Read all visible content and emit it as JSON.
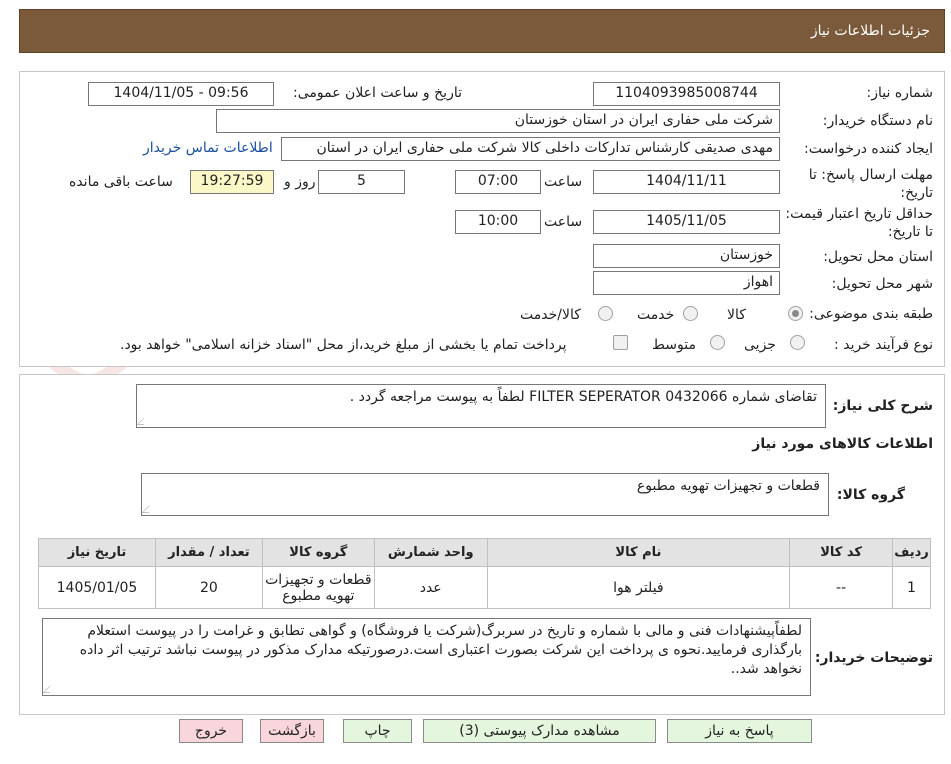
{
  "header": {
    "title": "جزئیات اطلاعات نیاز"
  },
  "watermark": {
    "text": "AriaTender.net"
  },
  "form": {
    "need_number": {
      "label": "شماره نیاز:",
      "value": "1104093985008744"
    },
    "announce_datetime": {
      "label": "تاریخ و ساعت اعلان عمومی:",
      "value": "1404/11/05 - 09:56"
    },
    "buyer_org": {
      "label": "نام دستگاه خریدار:",
      "value": "شرکت ملی حفاری ایران در استان خوزستان"
    },
    "requester": {
      "label": "ایجاد کننده درخواست:",
      "value": "مهدی صدیقی کارشناس تدارکات داخلی کالا شرکت ملی حفاری ایران در استان",
      "contact_link": "اطلاعات تماس خریدار"
    },
    "reply_deadline": {
      "label": "مهلت ارسال پاسخ: تا تاریخ:",
      "date": "1404/11/11",
      "time_label": "ساعت",
      "time": "07:00",
      "days": "5",
      "days_label": "روز و",
      "remaining_time": "19:27:59",
      "remaining_label": "ساعت باقی مانده"
    },
    "price_validity": {
      "label": "حداقل تاریخ اعتبار قیمت: تا تاریخ:",
      "date": "1405/11/05",
      "time_label": "ساعت",
      "time": "10:00"
    },
    "delivery_province": {
      "label": "استان محل تحویل:",
      "value": "خوزستان"
    },
    "delivery_city": {
      "label": "شهر محل تحویل:",
      "value": "اهواز"
    },
    "category": {
      "label": "طبقه بندی موضوعی:",
      "options": [
        "کالا",
        "خدمت",
        "کالا/خدمت"
      ],
      "selected": "کالا"
    },
    "purchase_process": {
      "label": "نوع فرآیند خرید :",
      "options": [
        "جزیی",
        "متوسط"
      ],
      "selected": "",
      "treasury_note": "پرداخت تمام یا بخشی از مبلغ خرید،از محل \"اسناد خزانه اسلامی\" خواهد بود."
    }
  },
  "description": {
    "label": "شرح کلی نیاز:",
    "value": "تقاضای شماره FILTER SEPERATOR 0432066 لطفاً به پیوست مراجعه گردد ."
  },
  "goods_section": {
    "title": "اطلاعات کالاهای مورد نیاز",
    "group_label": "گروه کالا:",
    "group_value": "قطعات و تجهیزات تهویه مطبوع"
  },
  "items_table": {
    "headers": [
      "ردیف",
      "کد کالا",
      "نام کالا",
      "واحد شمارش",
      "گروه کالا",
      "تعداد / مقدار",
      "تاریخ نیاز"
    ],
    "rows": [
      {
        "row": "1",
        "code": "--",
        "name": "فیلتر هوا",
        "unit": "عدد",
        "group": "قطعات و تجهیزات تهویه مطبوع",
        "qty": "20",
        "need_date": "1405/01/05"
      }
    ]
  },
  "buyer_notes": {
    "label": "توضیحات خریدار:",
    "value": "لطفاًپیشنهادات فنی و مالی با شماره و تاریخ در سربرگ(شرکت یا فروشگاه) و گواهی تطابق و غرامت را در پیوست استعلام بارگذاری فرمایید.نحوه ی پرداخت این شرکت بصورت اعتباری است.درصورتیکه مدارک مذکور در پیوست نباشد ترتیب اثر داده نخواهد شد.."
  },
  "buttons": {
    "reply": "پاسخ به نیاز",
    "view_docs": "مشاهده مدارک پیوستی (3)",
    "print": "چاپ",
    "back": "بازگشت",
    "exit": "خروج"
  },
  "colors": {
    "header_bg": "#7a5a3a",
    "link": "#1a4fa0",
    "btn_green": "#e4f6dd",
    "btn_pink": "#f9d6dc",
    "table_header": "#e3e3e3"
  }
}
